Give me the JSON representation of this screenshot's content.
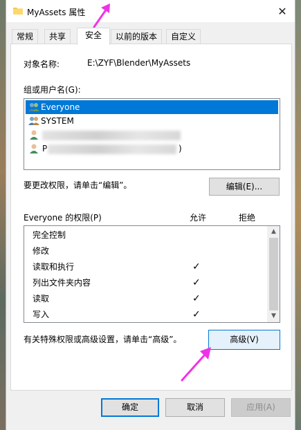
{
  "window": {
    "title": "MyAssets 属性",
    "close_glyph": "✕"
  },
  "tabs": [
    {
      "label": "常规"
    },
    {
      "label": "共享"
    },
    {
      "label": "安全",
      "active": true
    },
    {
      "label": "以前的版本"
    },
    {
      "label": "自定义"
    }
  ],
  "security": {
    "object_name_label": "对象名称:",
    "object_name_value": "E:\\ZYF\\Blender\\MyAssets",
    "groups_label": "组或用户名(G):",
    "users": [
      {
        "name": "Everyone",
        "selected": true,
        "icon": "group-icon"
      },
      {
        "name": "SYSTEM",
        "selected": false,
        "icon": "group-icon"
      },
      {
        "name": "",
        "selected": false,
        "icon": "user-icon",
        "redacted": true
      },
      {
        "name": ")",
        "selected": false,
        "icon": "user-icon",
        "redacted": true,
        "prefix": "P"
      }
    ],
    "change_hint": "要更改权限，请单击“编辑”。",
    "edit_button": "编辑(E)...",
    "permissions_header": "Everyone 的权限(P)",
    "allow_header": "允许",
    "deny_header": "拒绝",
    "permissions": [
      {
        "name": "完全控制",
        "allow": "",
        "deny": ""
      },
      {
        "name": "修改",
        "allow": "",
        "deny": ""
      },
      {
        "name": "读取和执行",
        "allow": "✓",
        "deny": ""
      },
      {
        "name": "列出文件夹内容",
        "allow": "✓",
        "deny": ""
      },
      {
        "name": "读取",
        "allow": "✓",
        "deny": ""
      },
      {
        "name": "写入",
        "allow": "✓",
        "deny": ""
      }
    ],
    "advanced_hint": "有关特殊权限或高级设置，请单击“高级”。",
    "advanced_button": "高级(V)"
  },
  "footer": {
    "ok": "确定",
    "cancel": "取消",
    "apply": "应用(A)"
  },
  "colors": {
    "selection": "#0078d7",
    "annotation_arrow": "#f032e6"
  }
}
